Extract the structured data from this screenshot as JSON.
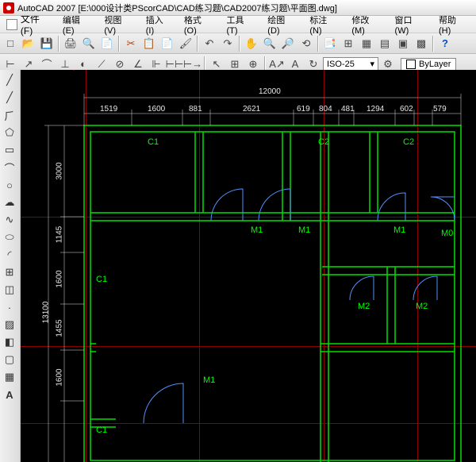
{
  "title": {
    "app": "AutoCAD 2007",
    "path": "[E:\\000设计类PScorCAD\\CAD练习题\\CAD2007练习题\\平面图.dwg]"
  },
  "menus": {
    "file": "文件(F)",
    "edit": "编辑(E)",
    "view": "视图(V)",
    "insert": "插入(I)",
    "format": "格式(O)",
    "tools": "工具(T)",
    "draw": "绘图(D)",
    "dim": "标注(N)",
    "modify": "修改(M)",
    "window": "窗口(W)",
    "help": "帮助(H)"
  },
  "toolbar2": {
    "dim_style": "ISO-25",
    "bylayer": "ByLayer"
  },
  "chart_data": {
    "type": "floorplan",
    "overall_width": 12000,
    "overall_height": 13100,
    "horizontal_dimensions": [
      {
        "value": 1519
      },
      {
        "value": 1600
      },
      {
        "value": 881
      },
      {
        "value": 2621
      },
      {
        "value": 619
      },
      {
        "value": 804
      },
      {
        "value": 481
      },
      {
        "value": 1294
      },
      {
        "value": 602
      },
      {
        "value": 579
      }
    ],
    "vertical_dimensions": [
      {
        "value": 3000
      },
      {
        "value": 1145
      },
      {
        "value": 1600
      },
      {
        "value": 1455
      },
      {
        "value": 1600
      }
    ],
    "room_labels": [
      {
        "name": "C1",
        "row": 1
      },
      {
        "name": "C2",
        "row": 1
      },
      {
        "name": "C2",
        "row": 1
      },
      {
        "name": "M1",
        "row": 1,
        "type": "door"
      },
      {
        "name": "M1",
        "row": 1,
        "type": "door"
      },
      {
        "name": "M1",
        "row": 1,
        "type": "door"
      },
      {
        "name": "M0",
        "row": 1,
        "type": "door"
      },
      {
        "name": "C1",
        "row": 2
      },
      {
        "name": "M2",
        "row": 2,
        "type": "door"
      },
      {
        "name": "M2",
        "row": 2,
        "type": "door"
      },
      {
        "name": "M1",
        "row": 3,
        "type": "door"
      },
      {
        "name": "C1",
        "row": 3
      }
    ]
  },
  "labels": {
    "dim_12000": "12000",
    "d1519": "1519",
    "d1600a": "1600",
    "d881": "881",
    "d2621": "2621",
    "d619": "619",
    "d804": "804",
    "d481": "481",
    "d1294": "1294",
    "d602": "602",
    "d579": "579",
    "v13100": "13100",
    "v3000": "3000",
    "v1145": "1145",
    "v1600a": "1600",
    "v1455": "1455",
    "v1600b": "1600",
    "C1a": "C1",
    "C2a": "C2",
    "C2b": "C2",
    "M1a": "M1",
    "M1b": "M1",
    "M1c": "M1",
    "M0": "M0",
    "C1b": "C1",
    "M2a": "M2",
    "M2b": "M2",
    "M1d": "M1",
    "C1c": "C1"
  }
}
